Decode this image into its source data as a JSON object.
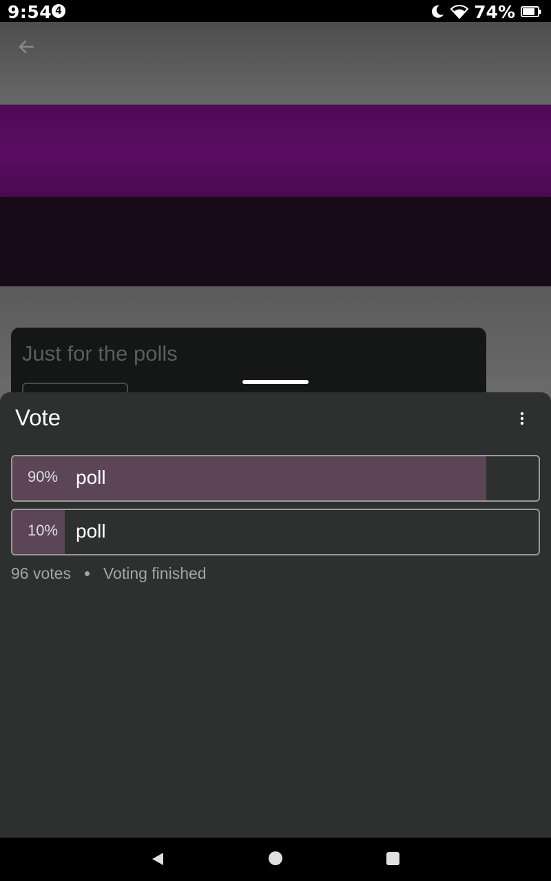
{
  "status_bar": {
    "time": "9:54",
    "notification_count": "4",
    "battery_percent": "74%",
    "icons": [
      "moon-icon",
      "wifi-icon",
      "battery-icon"
    ]
  },
  "background_app": {
    "back_icon": "arrow-left-icon",
    "card_title": "Just for the polls",
    "colors": {
      "purple_band": "#560b5e",
      "dark_band": "#170a19",
      "grey": "#6a6a6a"
    }
  },
  "sheet": {
    "title": "Vote",
    "menu_icon": "more-vertical-icon",
    "options": [
      {
        "percent_label": "90%",
        "label": "poll",
        "fill_fraction": 0.9
      },
      {
        "percent_label": "10%",
        "label": "poll",
        "fill_fraction": 0.1
      }
    ],
    "votes": "96 votes",
    "status": "Voting finished",
    "accent_fill_color": "#5b4556"
  },
  "nav_bar": {
    "icons": [
      "back-triangle-icon",
      "home-circle-icon",
      "recents-square-icon"
    ]
  }
}
